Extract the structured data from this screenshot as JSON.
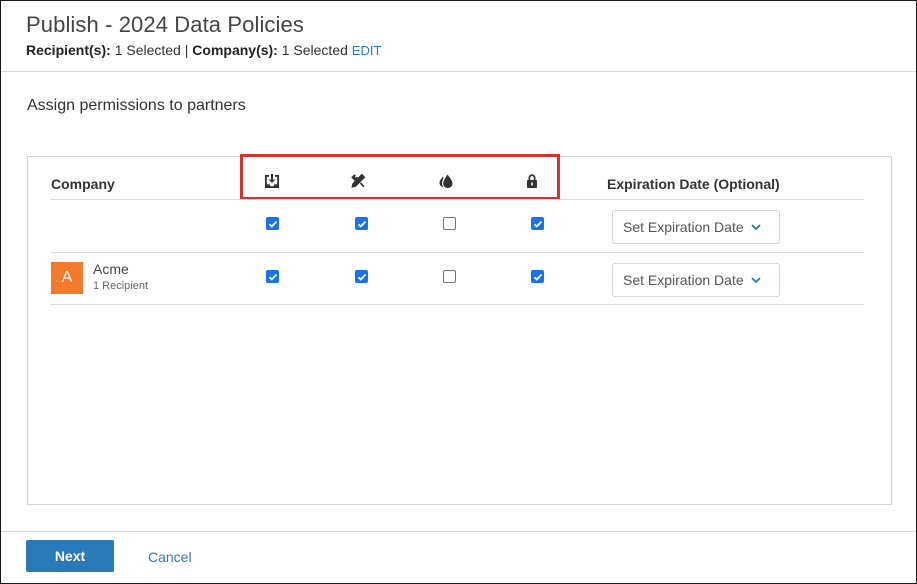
{
  "header": {
    "title": "Publish - 2024 Data Policies",
    "recipients_label": "Recipient(s):",
    "recipients_value": "1 Selected",
    "separator": "|",
    "companies_label": "Company(s):",
    "companies_value": "1 Selected",
    "edit_label": "EDIT"
  },
  "section": {
    "heading": "Assign permissions to partners"
  },
  "table": {
    "company_header": "Company",
    "expiration_header": "Expiration Date (Optional)",
    "permission_icons": [
      "download-icon",
      "edit-pencil-icon",
      "watermark-drop-icon",
      "lock-icon"
    ],
    "highlight_color": "#d9312b",
    "select_all_row": {
      "permissions": [
        true,
        true,
        false,
        true
      ],
      "expiration_placeholder": "Set Expiration Date"
    },
    "rows": [
      {
        "avatar_letter": "A",
        "avatar_color": "#f37a2a",
        "name": "Acme",
        "recipients": "1 Recipient",
        "permissions": [
          true,
          true,
          false,
          true
        ],
        "expiration_placeholder": "Set Expiration Date"
      }
    ]
  },
  "footer": {
    "next_label": "Next",
    "cancel_label": "Cancel",
    "primary_color": "#2a7ab7"
  }
}
